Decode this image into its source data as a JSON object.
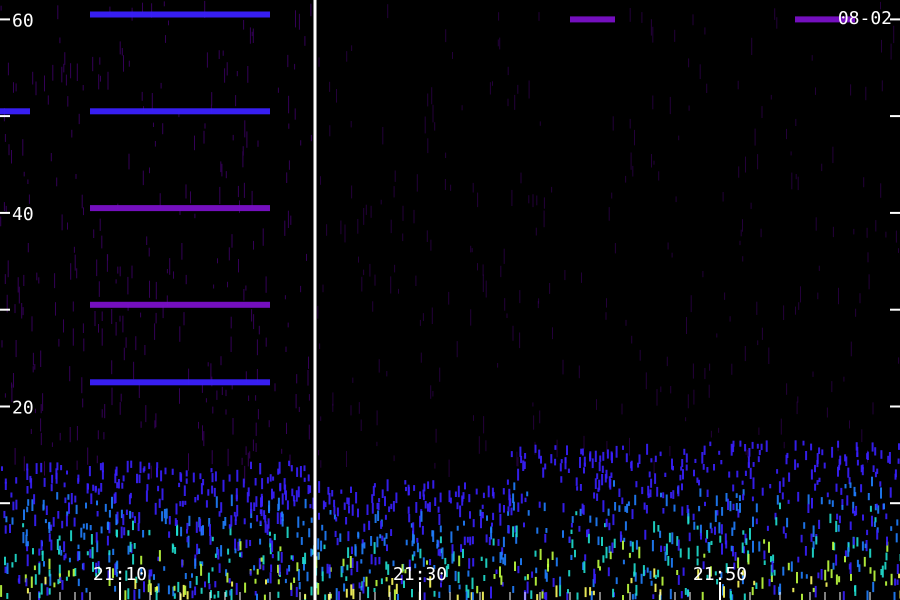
{
  "chart_data": {
    "type": "heatmap",
    "date_label": "08-02",
    "y_ticks": [
      {
        "value": 60,
        "label": "60"
      },
      {
        "value": 50,
        "label": ""
      },
      {
        "value": 40,
        "label": "40"
      },
      {
        "value": 30,
        "label": ""
      },
      {
        "value": 20,
        "label": "20"
      },
      {
        "value": 10,
        "label": ""
      }
    ],
    "ylim": [
      0,
      62
    ],
    "x_ticks": [
      {
        "time": "21:10",
        "label": "21:10"
      },
      {
        "time": "21:30",
        "label": "21:30"
      },
      {
        "time": "21:50",
        "label": "21:50"
      }
    ],
    "xlim": [
      "21:02",
      "22:02"
    ],
    "marker_time": "21:23",
    "colormap": [
      "#000000",
      "#3a0060",
      "#7a10c8",
      "#3a20ff",
      "#2080ff",
      "#20e0d0",
      "#c0ff40",
      "#ffff60"
    ],
    "bands": [
      {
        "y": 60.5,
        "t0": "21:08",
        "t1": "21:20",
        "level": 3
      },
      {
        "y": 50.5,
        "t0": "21:02",
        "t1": "21:04",
        "level": 3
      },
      {
        "y": 50.5,
        "t0": "21:08",
        "t1": "21:20",
        "level": 3
      },
      {
        "y": 40.5,
        "t0": "21:08",
        "t1": "21:20",
        "level": 2
      },
      {
        "y": 30.5,
        "t0": "21:08",
        "t1": "21:20",
        "level": 2
      },
      {
        "y": 22.5,
        "t0": "21:08",
        "t1": "21:20",
        "level": 3
      },
      {
        "y": 60,
        "t0": "21:40",
        "t1": "21:43",
        "level": 2
      },
      {
        "y": 60,
        "t0": "21:55",
        "t1": "21:59",
        "level": 2
      }
    ]
  }
}
